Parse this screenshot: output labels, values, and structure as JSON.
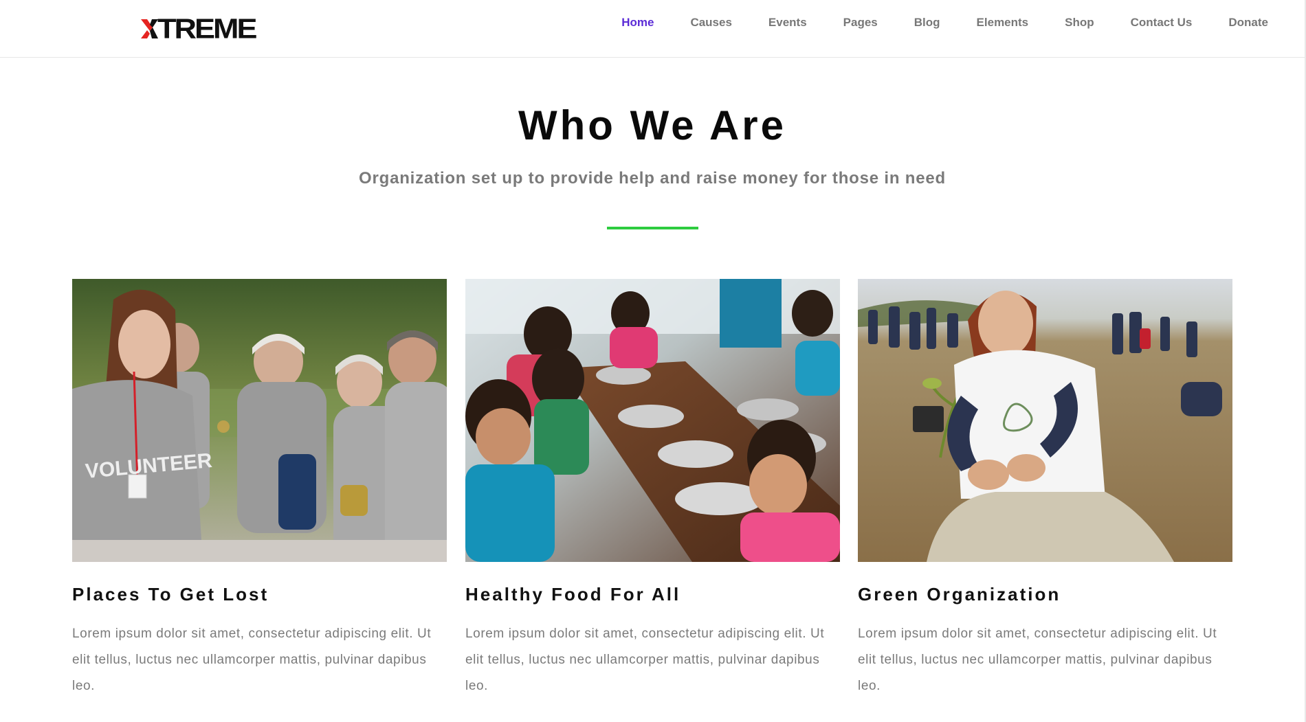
{
  "header": {
    "logo_text": "TREME",
    "logo_full": "XTREME",
    "nav": [
      {
        "label": "Home",
        "active": true
      },
      {
        "label": "Causes",
        "active": false
      },
      {
        "label": "Events",
        "active": false
      },
      {
        "label": "Pages",
        "active": false
      },
      {
        "label": "Blog",
        "active": false
      },
      {
        "label": "Elements",
        "active": false
      },
      {
        "label": "Shop",
        "active": false
      },
      {
        "label": "Contact Us",
        "active": false
      },
      {
        "label": "Donate",
        "active": false
      }
    ]
  },
  "intro": {
    "title": "Who We Are",
    "subtitle": "Organization set up to provide help and raise money for those in need"
  },
  "cards": [
    {
      "title": "Places To Get Lost",
      "text": "Lorem ipsum dolor sit amet, consectetur adipiscing elit. Ut elit tellus, luctus nec ullamcorper mattis, pulvinar dapibus leo."
    },
    {
      "title": "Healthy Food For All",
      "text": "Lorem ipsum dolor sit amet, consectetur adipiscing elit. Ut elit tellus, luctus nec ullamcorper mattis, pulvinar dapibus leo."
    },
    {
      "title": "Green Organization",
      "text": "Lorem ipsum dolor sit amet, consectetur adipiscing elit. Ut elit tellus, luctus nec ullamcorper mattis, pulvinar dapibus leo."
    }
  ],
  "colors": {
    "accent": "#5b2bd6",
    "divider": "#2ecc40",
    "logo_red": "#e52421",
    "nav_text": "#777777",
    "body_text": "#7a7a7a"
  },
  "icons": {
    "logo_mark": "x-logo-icon"
  }
}
